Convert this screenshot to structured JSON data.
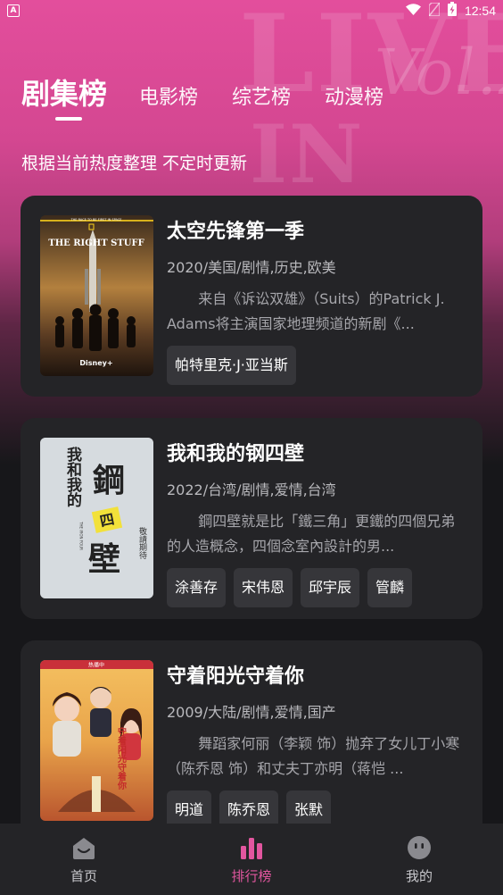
{
  "status_bar": {
    "notification_icon": "app-notification-icon",
    "notification_letter": "A",
    "time": "12:54"
  },
  "background_text": {
    "line1": "LIVE",
    "line2": "IN",
    "script": "Vol.2"
  },
  "tabs": [
    {
      "label": "剧集榜",
      "active": true
    },
    {
      "label": "电影榜",
      "active": false
    },
    {
      "label": "综艺榜",
      "active": false
    },
    {
      "label": "动漫榜",
      "active": false
    }
  ],
  "subtitle": "根据当前热度整理 不定时更新",
  "items": [
    {
      "title": "太空先锋第一季",
      "meta": "2020/美国/剧情,历史,欧美",
      "desc": "来自《诉讼双雄》（Suits）的Patrick J. Adams将主演国家地理频道的新剧《...",
      "tags": [
        "帕特里克·J·亚当斯"
      ],
      "poster": {
        "top_text": "THE RACE TO BE FIRST IN SPACE",
        "brand": "NATIONAL GEOGRAPHIC",
        "name": "THE RIGHT STUFF",
        "platform": "Disney+"
      }
    },
    {
      "title": "我和我的钢四壁",
      "meta": "2022/台湾/剧情,爱情,台湾",
      "desc": "鋼四壁就是比「鐵三角」更鐵的四個兄弟的人造概念，四個念室內設計的男...",
      "tags": [
        "涂善存",
        "宋伟恩",
        "邱宇辰",
        "管麟"
      ],
      "poster": {
        "name_a": "我和我的",
        "name_b": "鋼",
        "name_c": "壁",
        "badge": "四",
        "en": "THE IRON FOUR",
        "side": "敬請期待"
      }
    },
    {
      "title": "守着阳光守着你",
      "meta": "2009/大陆/剧情,爱情,国产",
      "desc": "舞蹈家何丽（李颖 饰）抛弃了女儿丁小寒（陈乔恩 饰）和丈夫丁亦明（蒋恺 ...",
      "tags": [
        "明道",
        "陈乔恩",
        "张默"
      ],
      "poster": {
        "name": "守着阳光守着你",
        "top_text": "热播中"
      }
    }
  ],
  "bottom_nav": [
    {
      "label": "首页",
      "icon": "home-icon",
      "active": false
    },
    {
      "label": "排行榜",
      "icon": "chart-icon",
      "active": true
    },
    {
      "label": "我的",
      "icon": "face-icon",
      "active": false
    }
  ],
  "colors": {
    "accent": "#e2569f",
    "hero_pink": "#e34e9c",
    "card_bg": "#242427",
    "page_bg": "#17171a",
    "tag_bg": "#36363a"
  }
}
